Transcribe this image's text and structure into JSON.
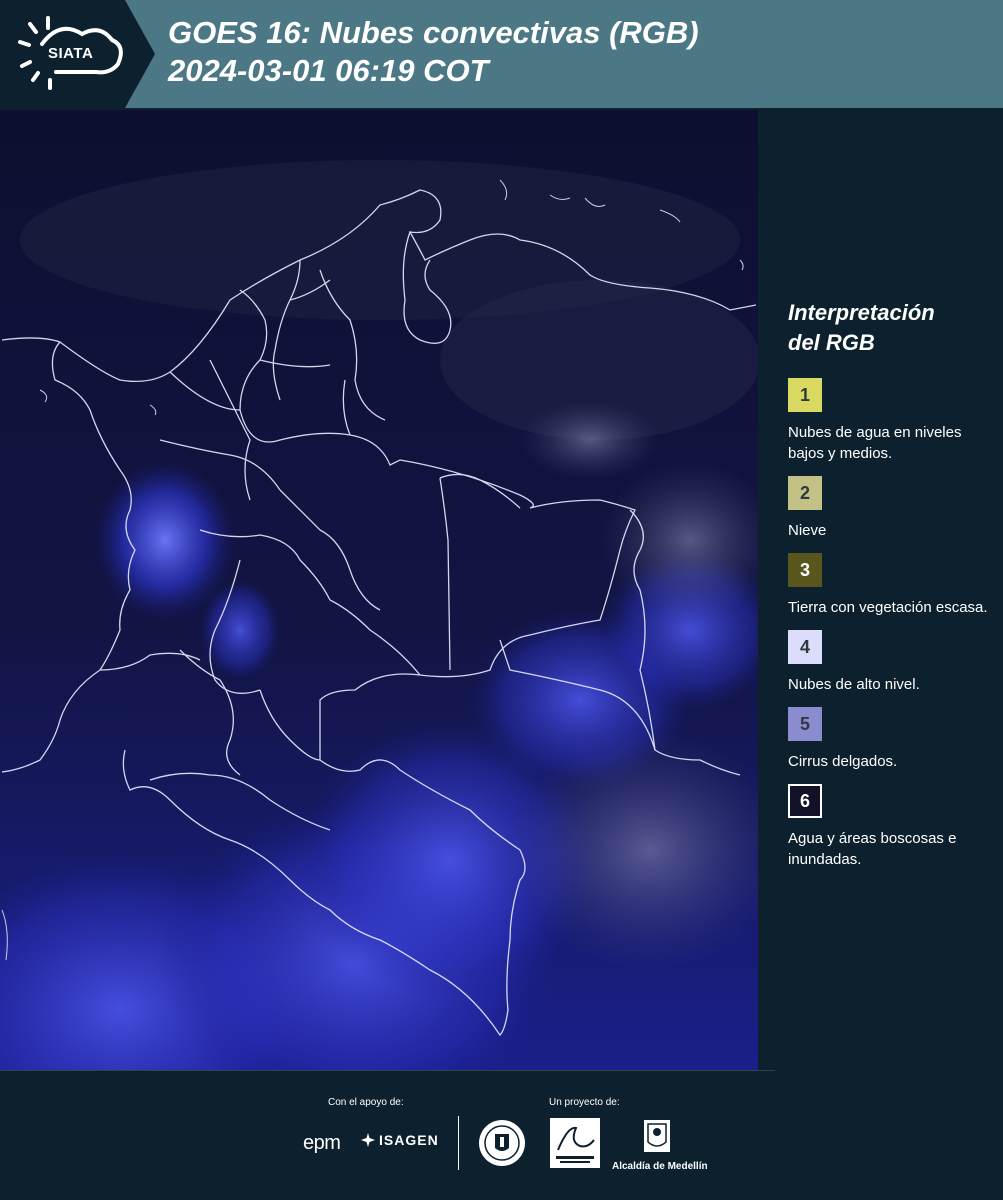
{
  "header": {
    "logo_text": "SIATA",
    "title_line1": "GOES 16: Nubes convectivas (RGB)",
    "title_line2": " 2024-03-01 06:19 COT"
  },
  "map": {
    "description_icon": "satellite-map-colombia"
  },
  "legend": {
    "title_line1": "Interpretación",
    "title_line2": "del RGB",
    "items": [
      {
        "number": "1",
        "label": "Nubes de agua en niveles bajos y medios.",
        "color": "#d9d962"
      },
      {
        "number": "2",
        "label": "Nieve",
        "color": "#c3c185"
      },
      {
        "number": "3",
        "label": "Tierra con vegetación escasa.",
        "color": "#58561c"
      },
      {
        "number": "4",
        "label": "Nubes de alto nivel.",
        "color": "#dcdcfb"
      },
      {
        "number": "5",
        "label": "Cirrus delgados.",
        "color": "#8b8bd0"
      },
      {
        "number": "6",
        "label": "Agua y áreas boscosas e inundadas.",
        "color": "#111128"
      }
    ]
  },
  "footer": {
    "support_label": "Con el apoyo de:",
    "project_label": "Un proyecto de:",
    "epm": "epm",
    "isagen": "ISAGEN",
    "alcaldia": "Alcaldía de Medellín"
  }
}
